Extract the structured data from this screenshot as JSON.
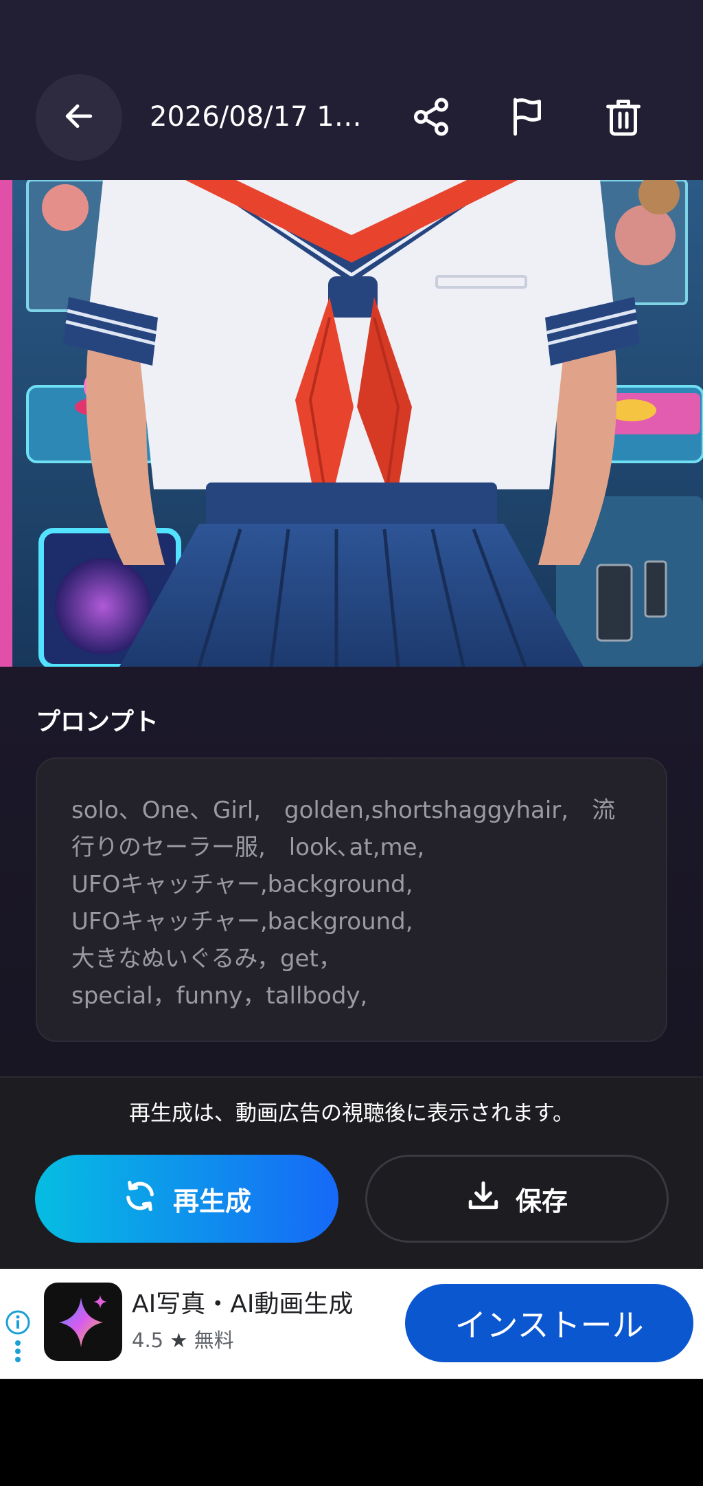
{
  "header": {
    "title": "2026/08/17 16:…",
    "icons": [
      "arrow-left-icon",
      "share-icon",
      "flag-icon",
      "trash-icon"
    ]
  },
  "artwork": {
    "subject": "anime girl in sailor uniform with red scarf in front of an arcade claw machine"
  },
  "prompt": {
    "label": "プロンプト",
    "text": "solo、One、Girl,　golden,shortshaggyhair,　流行りのセーラー服,　look､at,me,\nUFOキャッチャー,background,\nUFOキャッチャー,background,\n大きなぬいぐるみ，get，\nspecial，funny，tallbody,"
  },
  "actions": {
    "notice": "再生成は、動画広告の視聴後に表示されます。",
    "regenerate_label": "再生成",
    "save_label": "保存"
  },
  "ad": {
    "app_name": "AI写真・AI動画生成",
    "rating": "4.5",
    "star": "★",
    "price": "無料",
    "install_label": "インストール"
  },
  "colors": {
    "header_bg": "#221e33",
    "regen_gradient_start": "#06bde2",
    "regen_gradient_end": "#1669f7",
    "install_blue": "#0b57d0",
    "scarf_red": "#e8432c",
    "uniform_navy": "#26457f"
  }
}
